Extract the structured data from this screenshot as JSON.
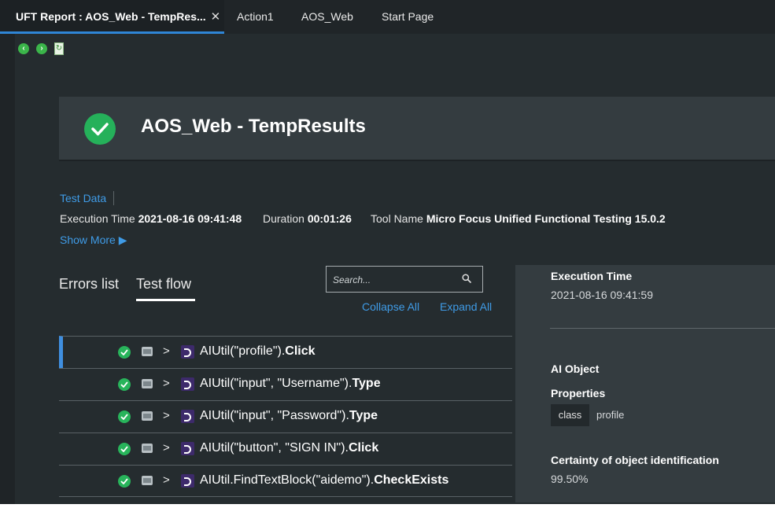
{
  "tabs": [
    {
      "label": "UFT Report : AOS_Web - TempRes...",
      "close": "✕"
    },
    {
      "label": "Action1"
    },
    {
      "label": "AOS_Web"
    },
    {
      "label": "Start Page"
    }
  ],
  "report": {
    "title": "AOS_Web - TempResults",
    "test_data_link": "Test Data",
    "execution_time_label": "Execution Time",
    "execution_time_value": "2021-08-16 09:41:48",
    "duration_label": "Duration",
    "duration_value": "00:01:26",
    "tool_name_label": "Tool Name",
    "tool_name_value": "Micro Focus Unified Functional Testing 15.0.2",
    "show_more": "Show More ▶"
  },
  "views": {
    "errors_list": "Errors list",
    "test_flow": "Test flow"
  },
  "search": {
    "placeholder": "Search..."
  },
  "flow_controls": {
    "collapse_all": "Collapse All",
    "expand_all": "Expand All"
  },
  "steps": [
    {
      "object": "AIUtil(\"profile\").",
      "action": "Click",
      "status": "passed"
    },
    {
      "object": "AIUtil(\"input\", \"Username\").",
      "action": "Type",
      "status": "passed"
    },
    {
      "object": "AIUtil(\"input\", \"Password\").",
      "action": "Type",
      "status": "passed"
    },
    {
      "object": "AIUtil(\"button\", \"SIGN IN\").",
      "action": "Click",
      "status": "passed"
    },
    {
      "object": "AIUtil.FindTextBlock(\"aidemo\").",
      "action": "CheckExists",
      "status": "passed"
    }
  ],
  "details": {
    "execution_time_label": "Execution Time",
    "execution_time_value": "2021-08-16 09:41:59",
    "ai_object_label": "AI Object",
    "properties_label": "Properties",
    "property_key": "class",
    "property_value": "profile",
    "certainty_label": "Certainty of object identification",
    "certainty_value": "99.50%"
  },
  "icons": {
    "back": "arrow-left-icon",
    "forward": "arrow-right-icon",
    "refresh": "refresh-icon",
    "status": "check-icon",
    "search": "search-icon"
  },
  "colors": {
    "accent": "#3f9be6",
    "pass": "#25b15a",
    "tab_underline": "#2f86d6"
  }
}
